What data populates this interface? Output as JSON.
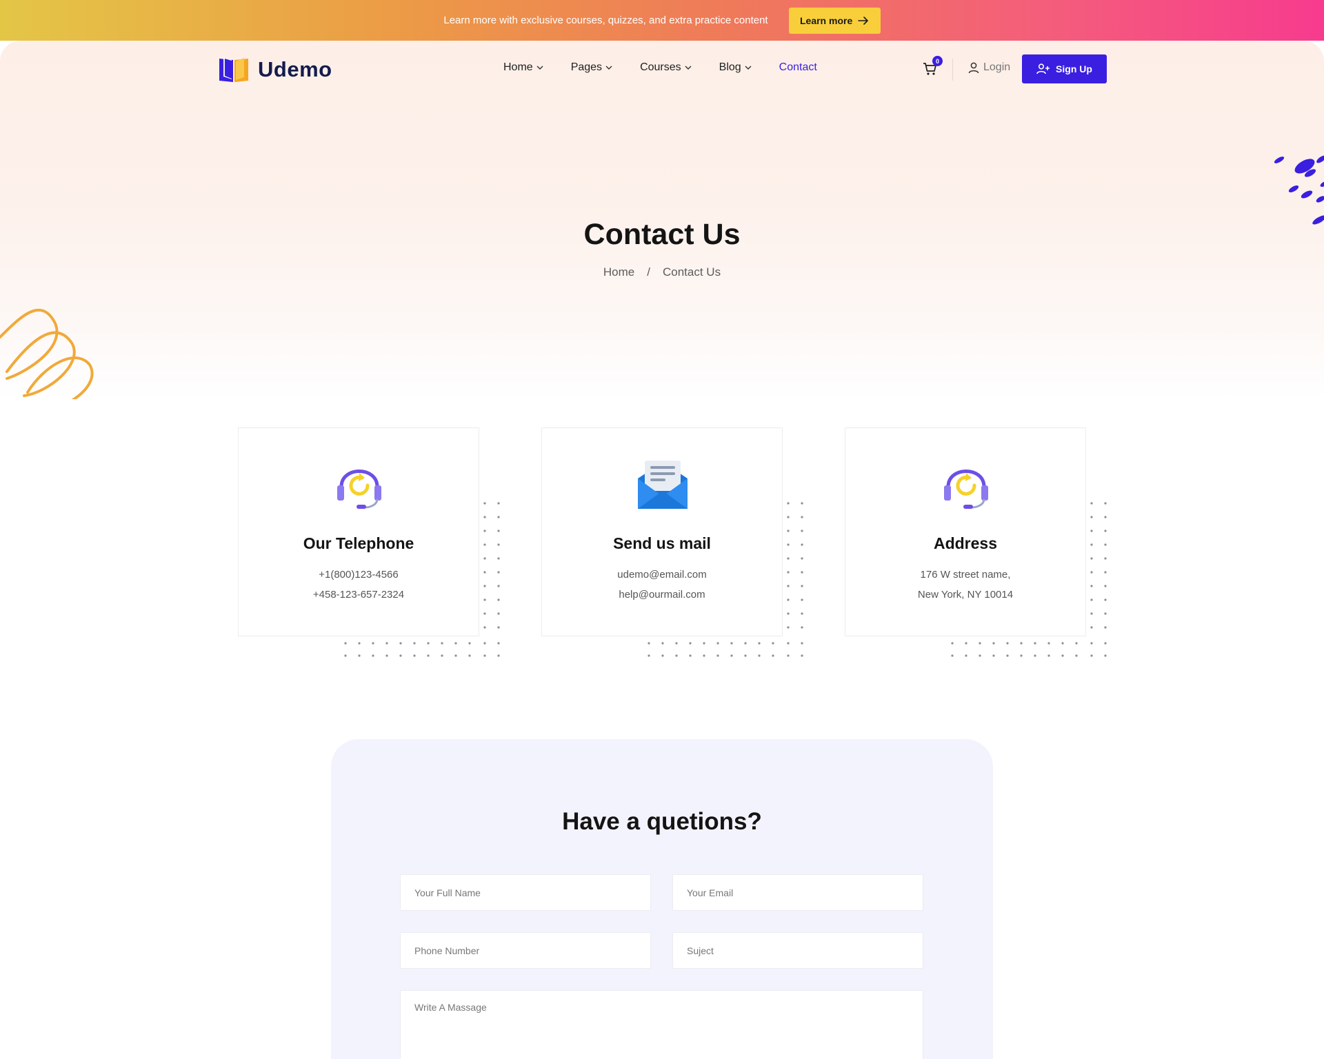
{
  "promo": {
    "text": "Learn more with exclusive courses, quizzes, and extra practice content",
    "button_label": "Learn more"
  },
  "brand": {
    "name": "Udemo"
  },
  "nav": {
    "items": [
      {
        "label": "Home",
        "has_dropdown": true
      },
      {
        "label": "Pages",
        "has_dropdown": true
      },
      {
        "label": "Courses",
        "has_dropdown": true
      },
      {
        "label": "Blog",
        "has_dropdown": true
      },
      {
        "label": "Contact",
        "has_dropdown": false,
        "active": true
      }
    ],
    "cart_count": "0",
    "login_label": "Login",
    "signup_label": "Sign Up"
  },
  "hero": {
    "title": "Contact Us",
    "breadcrumb": {
      "home": "Home",
      "separator": "/",
      "current": "Contact Us"
    }
  },
  "cards": [
    {
      "icon": "headset-icon",
      "title": "Our Telephone",
      "lines": [
        "+1(800)123-4566",
        "+458-123-657-2324"
      ]
    },
    {
      "icon": "mail-icon",
      "title": "Send us mail",
      "lines": [
        "udemo@email.com",
        "help@ourmail.com"
      ]
    },
    {
      "icon": "headset-icon",
      "title": "Address",
      "lines": [
        "176 W street name,",
        "New York, NY 10014"
      ]
    }
  ],
  "form": {
    "title": "Have a quetions?",
    "fields": {
      "name_placeholder": "Your Full Name",
      "email_placeholder": "Your Email",
      "phone_placeholder": "Phone Number",
      "subject_placeholder": "Suject",
      "message_placeholder": "Write A Massage"
    }
  },
  "colors": {
    "accent": "#3a1fe0",
    "promo_button": "#f8cf3a",
    "hero_bg": "#fdefe8",
    "form_bg": "#f3f3fd",
    "decor_orange": "#f1a93a"
  }
}
